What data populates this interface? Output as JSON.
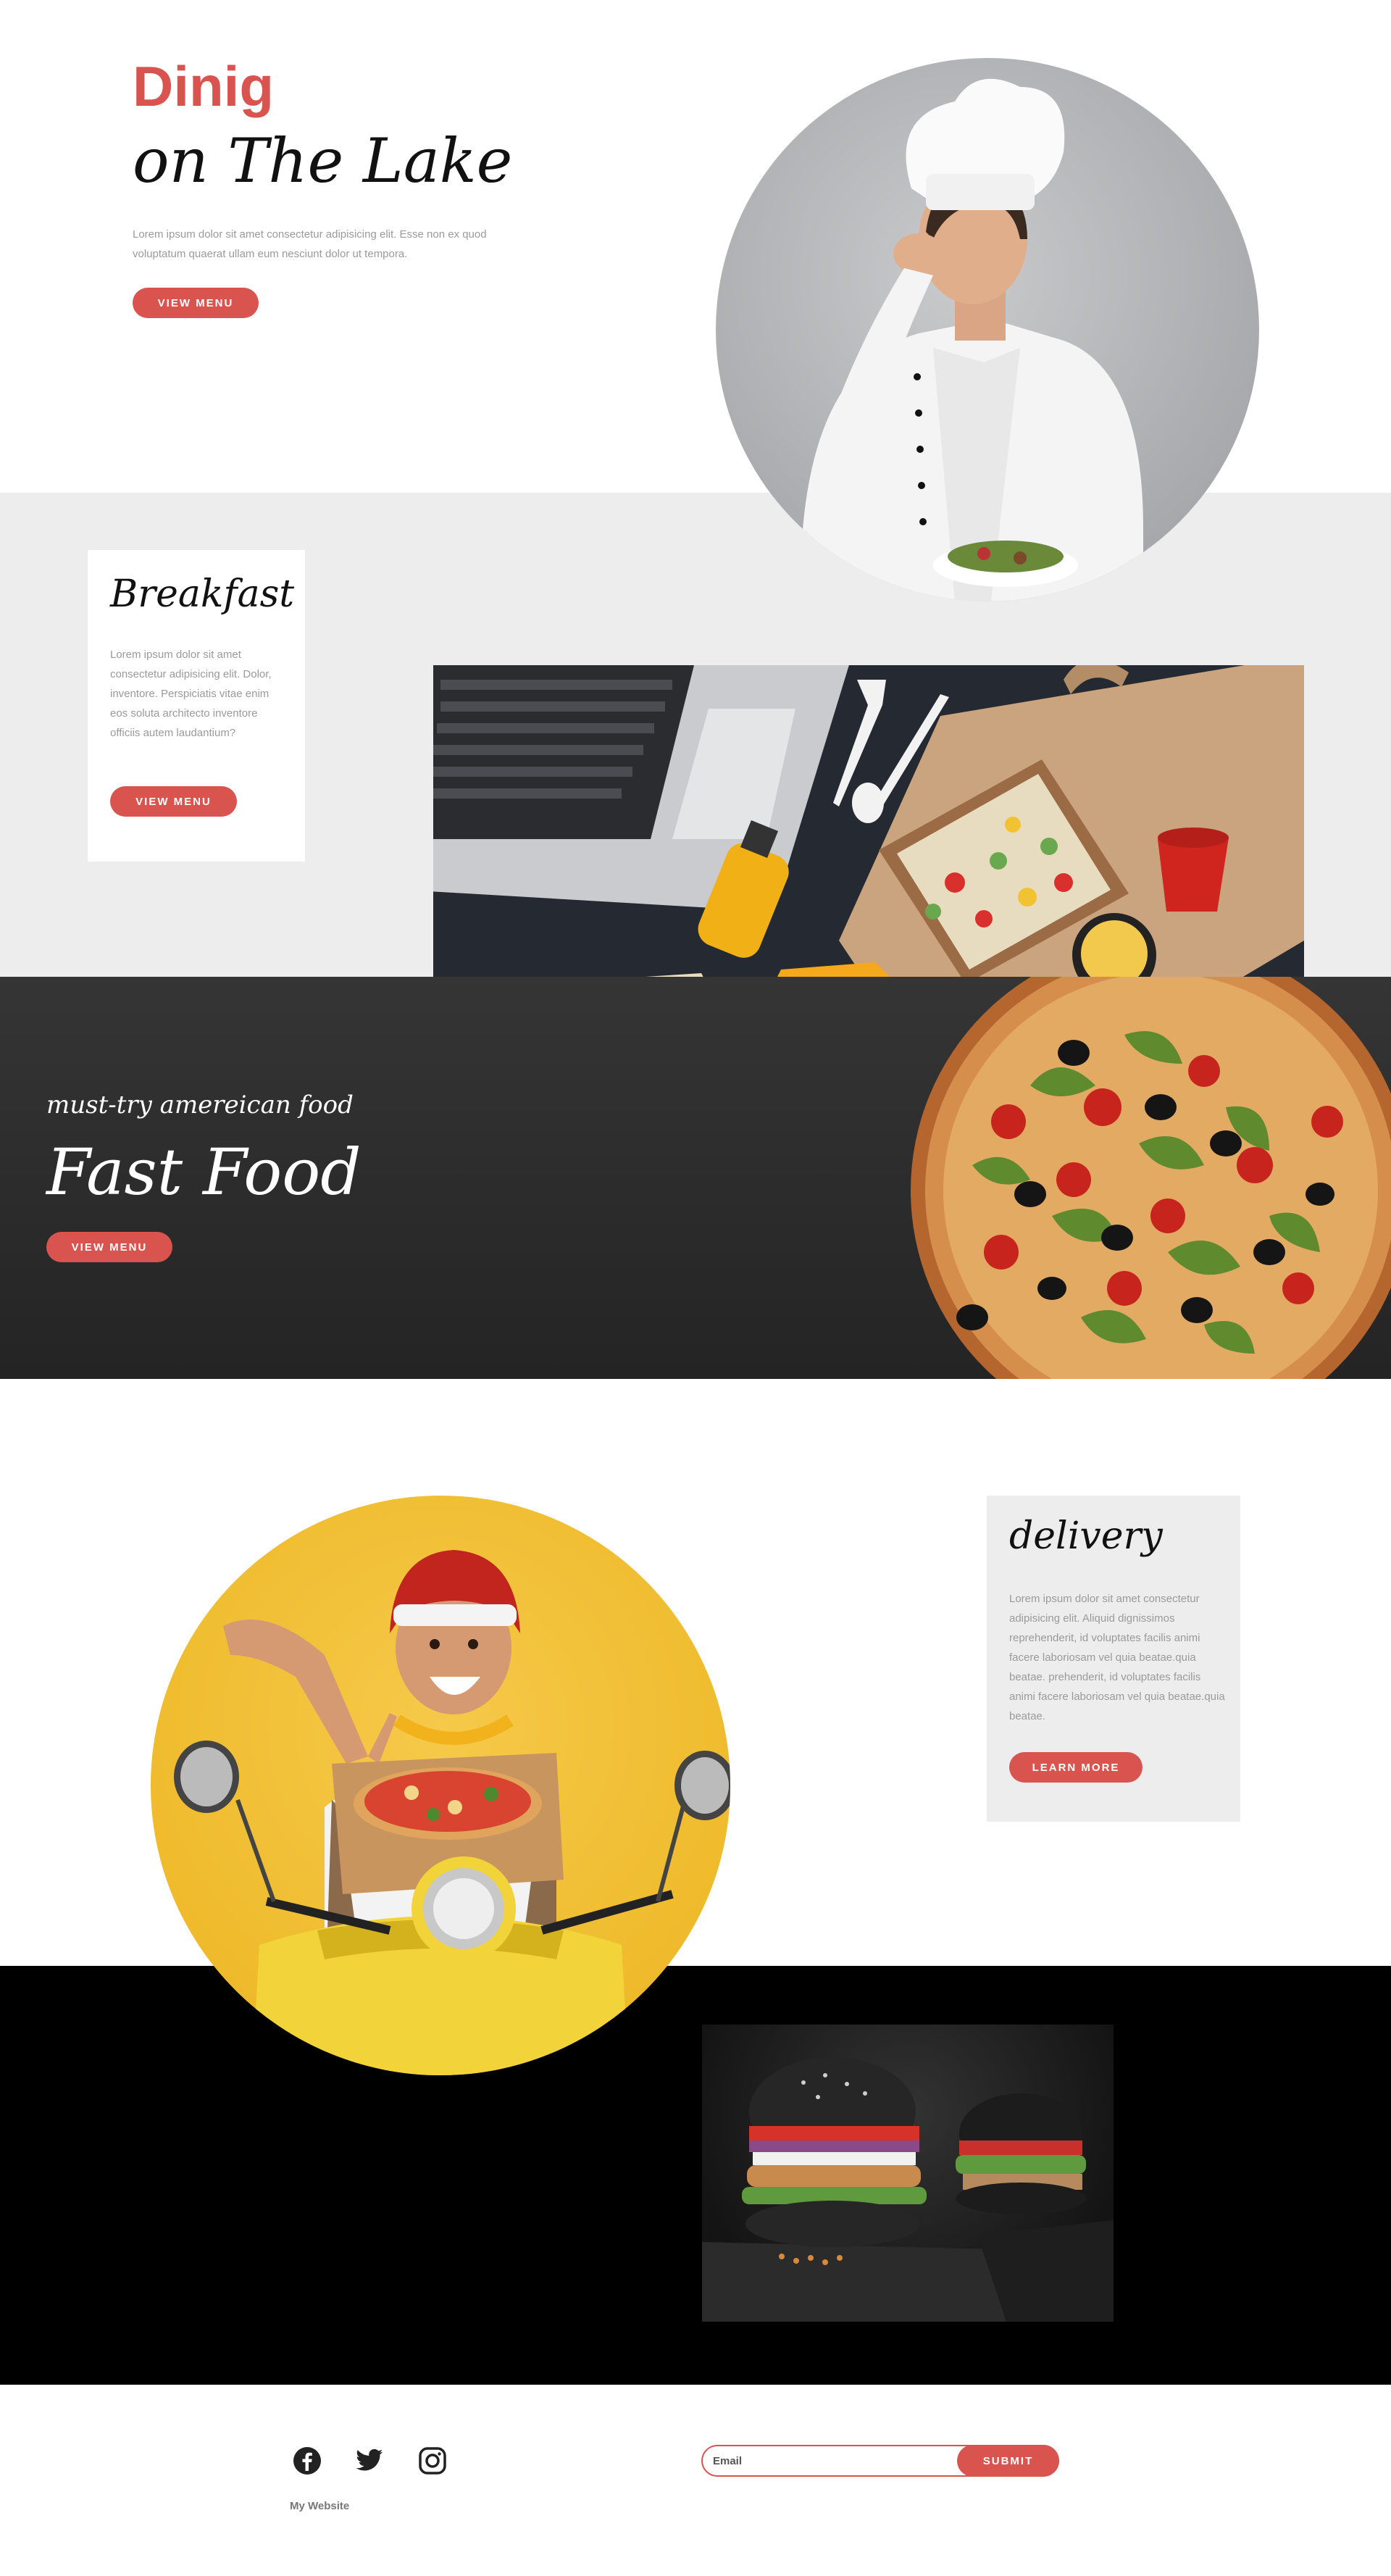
{
  "hero": {
    "title_accent": "Dinig",
    "title_main": "on The Lake",
    "description": "Lorem ipsum dolor sit amet consectetur adipisicing elit. Esse non ex quod voluptatum quaerat ullam eum nesciunt dolor ut tempora.",
    "button_label": "VIEW MENU"
  },
  "breakfast": {
    "title": "Breakfast",
    "description": "Lorem ipsum dolor sit amet consectetur adipisicing elit. Dolor, inventore. Perspiciatis vitae enim eos soluta architecto inventore officiis autem laudantium?",
    "button_label": "VIEW MENU"
  },
  "fastfood": {
    "subtitle": "must-try amereican food",
    "title": "Fast Food",
    "button_label": "VIEW MENU"
  },
  "delivery": {
    "title": "delivery",
    "description": "Lorem ipsum dolor sit amet consectetur adipisicing elit. Aliquid dignissimos reprehenderit, id voluptates facilis animi facere laboriosam vel quia beatae.quia beatae. prehenderit, id voluptates facilis animi facere laboriosam vel quia beatae.quia beatae.",
    "button_label": "LEARN MORE"
  },
  "footer": {
    "brand": "My Website",
    "email_placeholder": "Email",
    "submit_label": "SUBMIT",
    "social_icons": [
      "facebook-icon",
      "twitter-icon",
      "instagram-icon"
    ]
  },
  "colors": {
    "accent": "#d9534f",
    "light_band": "#ededed",
    "dark_band": "#2b2b2b",
    "black_band": "#000000"
  }
}
